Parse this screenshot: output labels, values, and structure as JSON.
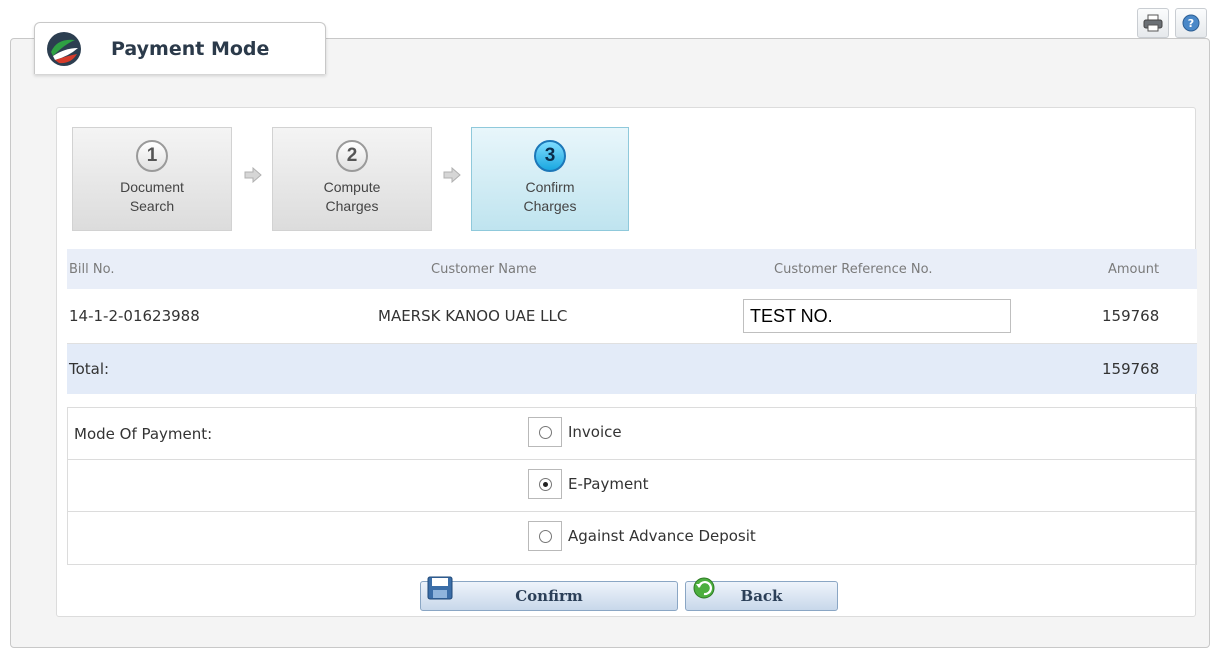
{
  "page": {
    "title": "Payment Mode"
  },
  "toolbar": {
    "icons": [
      "printer-icon",
      "help-icon"
    ]
  },
  "wizard": {
    "steps": [
      {
        "number": "1",
        "label_line1": "Document",
        "label_line2": "Search",
        "active": false
      },
      {
        "number": "2",
        "label_line1": "Compute",
        "label_line2": "Charges",
        "active": false
      },
      {
        "number": "3",
        "label_line1": "Confirm",
        "label_line2": "Charges",
        "active": true
      }
    ]
  },
  "table": {
    "headers": {
      "bill_no": "Bill No.",
      "customer_name": "Customer Name",
      "customer_ref": "Customer Reference No.",
      "amount": "Amount"
    },
    "rows": [
      {
        "bill_no": "14-1-2-01623988",
        "customer_name": "MAERSK KANOO UAE LLC",
        "customer_ref": "TEST NO.",
        "amount": "159768"
      }
    ],
    "total": {
      "label": "Total:",
      "amount": "159768"
    }
  },
  "payment": {
    "label": "Mode Of Payment:",
    "options": [
      {
        "label": "Invoice",
        "checked": false
      },
      {
        "label": "E-Payment",
        "checked": true
      },
      {
        "label": "Against Advance Deposit",
        "checked": false
      }
    ]
  },
  "actions": {
    "confirm_label": "Confirm",
    "back_label": "Back"
  },
  "colors": {
    "active_step": "#bfe4ef",
    "header_bg": "#e9eef8",
    "button_text": "#2b3f58"
  }
}
